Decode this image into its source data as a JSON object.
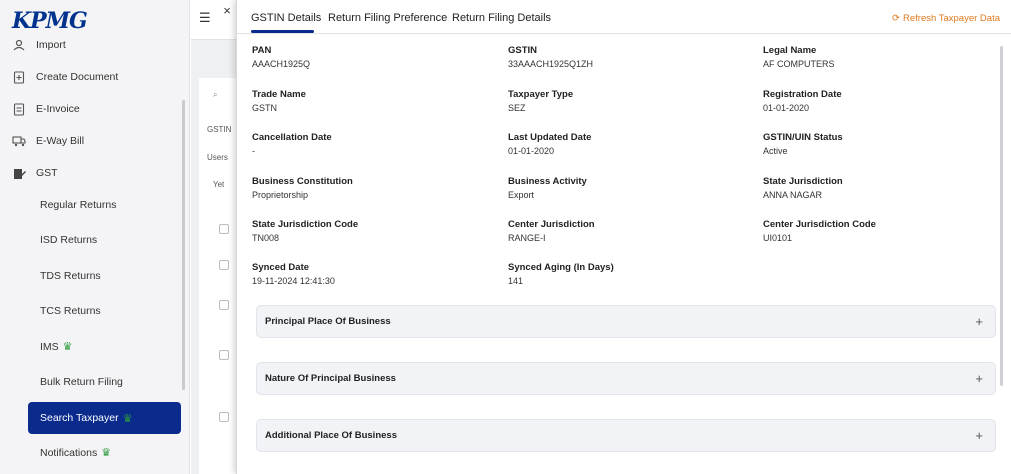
{
  "sidebar": {
    "logo": "KPMG",
    "items": [
      {
        "label": "Import",
        "icon": "import-icon"
      },
      {
        "label": "Create Document",
        "icon": "document-plus-icon"
      },
      {
        "label": "E-Invoice",
        "icon": "invoice-icon"
      },
      {
        "label": "E-Way Bill",
        "icon": "truck-icon"
      },
      {
        "label": "GST",
        "icon": "gst-icon"
      }
    ],
    "sub_items": [
      "Regular Returns",
      "ISD Returns",
      "TDS Returns",
      "TCS Returns",
      "IMS",
      "Bulk Return Filing",
      "Search Taxpayer",
      "Notifications"
    ]
  },
  "background": {
    "search_icon": "search-icon",
    "gstin_label": "GSTIN",
    "users_label": "Users",
    "status_label": "Yet"
  },
  "panel": {
    "close": "×",
    "tabs": [
      "GSTIN Details",
      "Return Filing Preference",
      "Return Filing Details"
    ],
    "refresh": "Refresh Taxpayer Data",
    "fields": [
      {
        "label": "PAN",
        "value": "AAACH1925Q"
      },
      {
        "label": "GSTIN",
        "value": "33AAACH1925Q1ZH"
      },
      {
        "label": "Legal Name",
        "value": "AF COMPUTERS"
      },
      {
        "label": "Trade Name",
        "value": "GSTN"
      },
      {
        "label": "Taxpayer Type",
        "value": "SEZ"
      },
      {
        "label": "Registration Date",
        "value": "01-01-2020"
      },
      {
        "label": "Cancellation Date",
        "value": "-"
      },
      {
        "label": "Last Updated Date",
        "value": "01-01-2020"
      },
      {
        "label": "GSTIN/UIN Status",
        "value": "Active"
      },
      {
        "label": "Business Constitution",
        "value": "Proprietorship"
      },
      {
        "label": "Business Activity",
        "value": "Export"
      },
      {
        "label": "State Jurisdiction",
        "value": "ANNA NAGAR"
      },
      {
        "label": "State Jurisdiction Code",
        "value": "TN008"
      },
      {
        "label": "Center Jurisdiction",
        "value": "RANGE-I"
      },
      {
        "label": "Center Jurisdiction Code",
        "value": "UI0101"
      },
      {
        "label": "Synced Date",
        "value": "19-11-2024 12:41:30"
      },
      {
        "label": "Synced Aging (In Days)",
        "value": "141"
      }
    ],
    "accordions": [
      "Principal Place Of Business",
      "Nature Of Principal Business",
      "Additional Place Of Business"
    ],
    "plus": "+"
  },
  "colors": {
    "accent": "#0a2a8c",
    "refresh": "#e07a1f",
    "star": "#2e9b3a"
  }
}
